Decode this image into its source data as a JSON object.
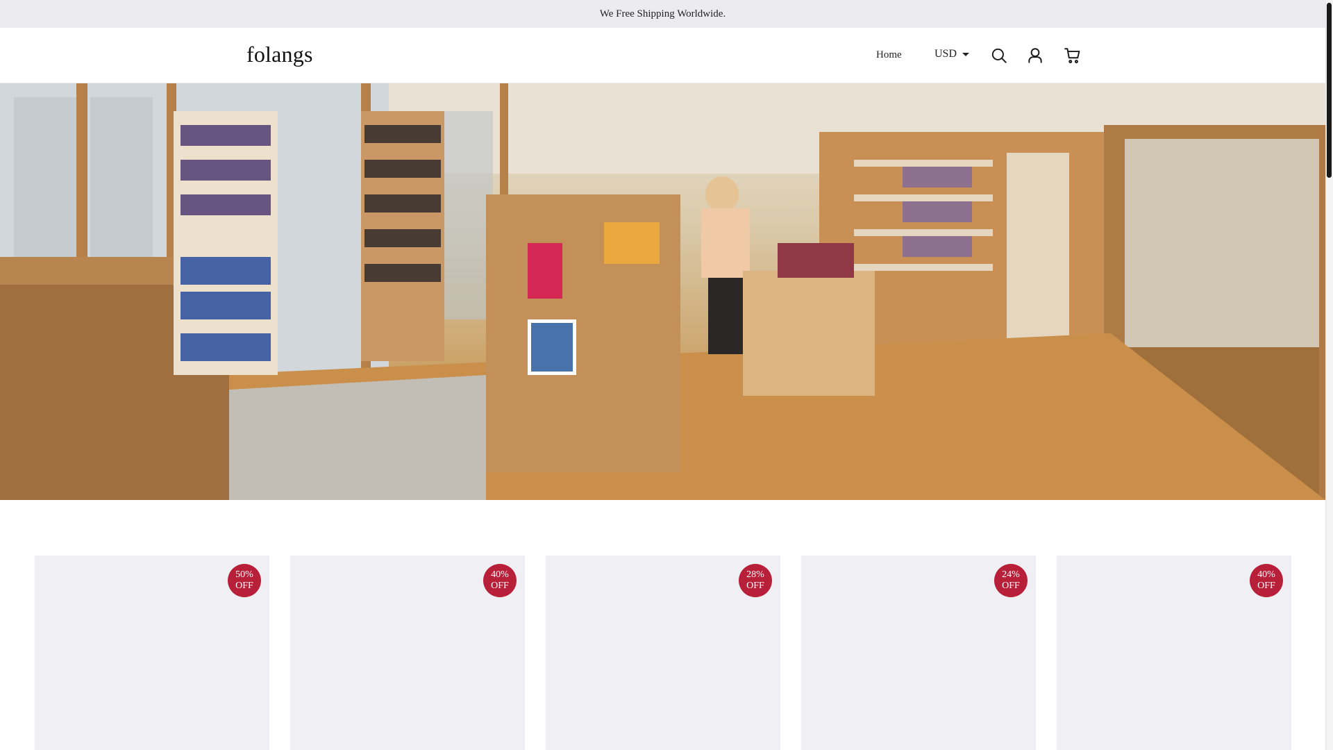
{
  "announcement": {
    "text": "We Free Shipping Worldwide."
  },
  "header": {
    "logo": "folangs",
    "nav": [
      {
        "label": "Home"
      }
    ],
    "currency": {
      "selected": "USD"
    },
    "icons": [
      "search-icon",
      "account-icon",
      "cart-icon"
    ]
  },
  "hero": {
    "description_icon": "store-interior-photo"
  },
  "products": [
    {
      "discount_pct": "50%",
      "discount_word": "OFF"
    },
    {
      "discount_pct": "40%",
      "discount_word": "OFF"
    },
    {
      "discount_pct": "28%",
      "discount_word": "OFF"
    },
    {
      "discount_pct": "24%",
      "discount_word": "OFF"
    },
    {
      "discount_pct": "40%",
      "discount_word": "OFF"
    }
  ],
  "colors": {
    "badge": "#b8203a",
    "announce_bg": "#ececee",
    "card_bg": "#f0f0f4"
  }
}
